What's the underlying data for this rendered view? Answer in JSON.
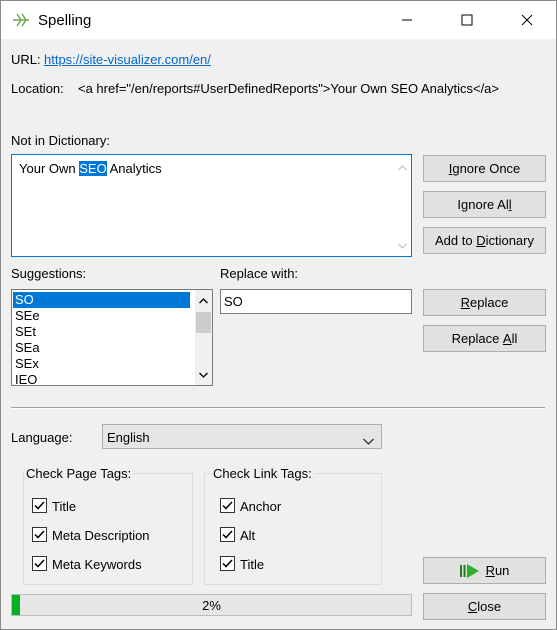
{
  "window": {
    "title": "Spelling"
  },
  "url": {
    "label": "URL:",
    "value": "https://site-visualizer.com/en/"
  },
  "location": {
    "label": "Location:",
    "value": "<a href=\"/en/reports#UserDefinedReports\">Your Own SEO Analytics</a>"
  },
  "not_in_dictionary": {
    "label": "Not in Dictionary:",
    "text_before": "Your Own ",
    "highlighted_word": "SEO",
    "text_after": " Analytics"
  },
  "buttons": {
    "ignore_once": {
      "u": "I",
      "rest": "gnore Once"
    },
    "ignore_all": {
      "pre": "Ignore Al",
      "u": "l",
      "rest": ""
    },
    "add_to_dictionary": {
      "pre": "Add to ",
      "u": "D",
      "rest": "ictionary"
    },
    "replace": {
      "u": "R",
      "rest": "eplace"
    },
    "replace_all": {
      "pre": "Replace ",
      "u": "A",
      "rest": "ll"
    },
    "run": {
      "u": "R",
      "rest": "un"
    },
    "close": {
      "u": "C",
      "rest": "lose"
    }
  },
  "suggestions": {
    "label": "Suggestions:",
    "items": [
      "SO",
      "SEe",
      "SEt",
      "SEa",
      "SEx",
      "IEO"
    ],
    "selected": "SO"
  },
  "replace_with": {
    "label": "Replace with:",
    "value": "SO"
  },
  "language": {
    "label": "Language:",
    "selected": "English"
  },
  "check_page_tags": {
    "label": "Check Page Tags:",
    "items": [
      {
        "label": "Title",
        "checked": true
      },
      {
        "label": "Meta Description",
        "checked": true
      },
      {
        "label": "Meta Keywords",
        "checked": true
      }
    ]
  },
  "check_link_tags": {
    "label": "Check Link Tags:",
    "items": [
      {
        "label": "Anchor",
        "checked": true
      },
      {
        "label": "Alt",
        "checked": true
      },
      {
        "label": "Title",
        "checked": true
      }
    ]
  },
  "progress": {
    "value": 0.02,
    "text": "2%"
  },
  "colors": {
    "accent": "#0078d7",
    "progress": "#06b025",
    "link": "#0066cc"
  }
}
